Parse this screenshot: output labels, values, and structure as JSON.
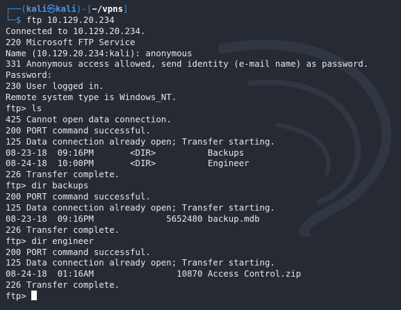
{
  "prompt": {
    "box_open": "┌──(",
    "user": "kali",
    "at": "㉿",
    "host": "kali",
    "box_mid": ")-[",
    "path": "~/vpns",
    "box_close": "]",
    "box_bottom": "└─",
    "dollar": "$",
    "command": " ftp 10.129.20.234"
  },
  "output_lines": [
    "Connected to 10.129.20.234.",
    "220 Microsoft FTP Service",
    "Name (10.129.20.234:kali): anonymous",
    "331 Anonymous access allowed, send identity (e-mail name) as password.",
    "Password:",
    "230 User logged in.",
    "Remote system type is Windows_NT.",
    "ftp> ls",
    "425 Cannot open data connection.",
    "200 PORT command successful.",
    "125 Data connection already open; Transfer starting.",
    "08-23-18  09:16PM       <DIR>          Backups",
    "08-24-18  10:00PM       <DIR>          Engineer",
    "226 Transfer complete.",
    "ftp> dir backups",
    "200 PORT command successful.",
    "125 Data connection already open; Transfer starting.",
    "08-23-18  09:16PM              5652480 backup.mdb",
    "226 Transfer complete.",
    "ftp> dir engineer",
    "200 PORT command successful.",
    "125 Data connection already open; Transfer starting.",
    "08-24-18  01:16AM                10870 Access Control.zip",
    "226 Transfer complete."
  ],
  "current_prompt": "ftp> ",
  "colors": {
    "background": "#262a33",
    "text": "#e6e6e6",
    "prompt_blue": "#4d95e8",
    "cursor": "#ffffff"
  }
}
